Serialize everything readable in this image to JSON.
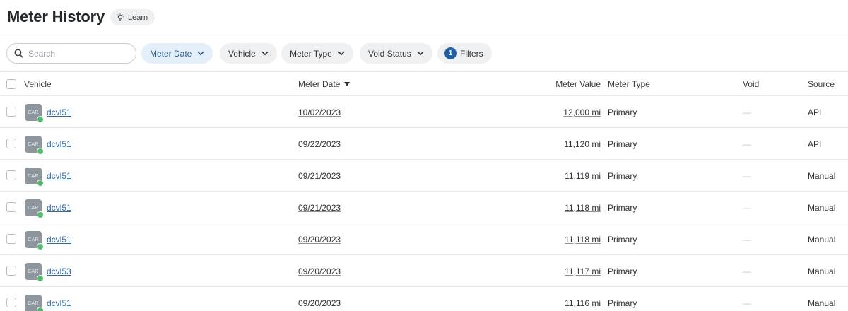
{
  "header": {
    "title": "Meter History",
    "learn_label": "Learn"
  },
  "toolbar": {
    "search_placeholder": "Search",
    "filters": [
      {
        "label": "Meter Date"
      },
      {
        "label": "Vehicle"
      },
      {
        "label": "Meter Type"
      },
      {
        "label": "Void Status"
      }
    ],
    "filters_count": "1",
    "filters_label": "Filters"
  },
  "table": {
    "columns": {
      "vehicle": "Vehicle",
      "meter_date": "Meter Date",
      "meter_value": "Meter Value",
      "meter_type": "Meter Type",
      "void": "Void",
      "source": "Source"
    },
    "avatar_text": "CAR",
    "rows": [
      {
        "vehicle": "dcvl51",
        "date": "10/02/2023",
        "value": "12,000 mi",
        "type": "Primary",
        "void": "—",
        "source": "API"
      },
      {
        "vehicle": "dcvl51",
        "date": "09/22/2023",
        "value": "11,120 mi",
        "type": "Primary",
        "void": "—",
        "source": "API"
      },
      {
        "vehicle": "dcvl51",
        "date": "09/21/2023",
        "value": "11,119 mi",
        "type": "Primary",
        "void": "—",
        "source": "Manual"
      },
      {
        "vehicle": "dcvl51",
        "date": "09/21/2023",
        "value": "11,118 mi",
        "type": "Primary",
        "void": "—",
        "source": "Manual"
      },
      {
        "vehicle": "dcvl51",
        "date": "09/20/2023",
        "value": "11,118 mi",
        "type": "Primary",
        "void": "—",
        "source": "Manual"
      },
      {
        "vehicle": "dcvl53",
        "date": "09/20/2023",
        "value": "11,117 mi",
        "type": "Primary",
        "void": "—",
        "source": "Manual"
      },
      {
        "vehicle": "dcvl51",
        "date": "09/20/2023",
        "value": "11,116 mi",
        "type": "Primary",
        "void": "—",
        "source": "Manual"
      }
    ]
  }
}
